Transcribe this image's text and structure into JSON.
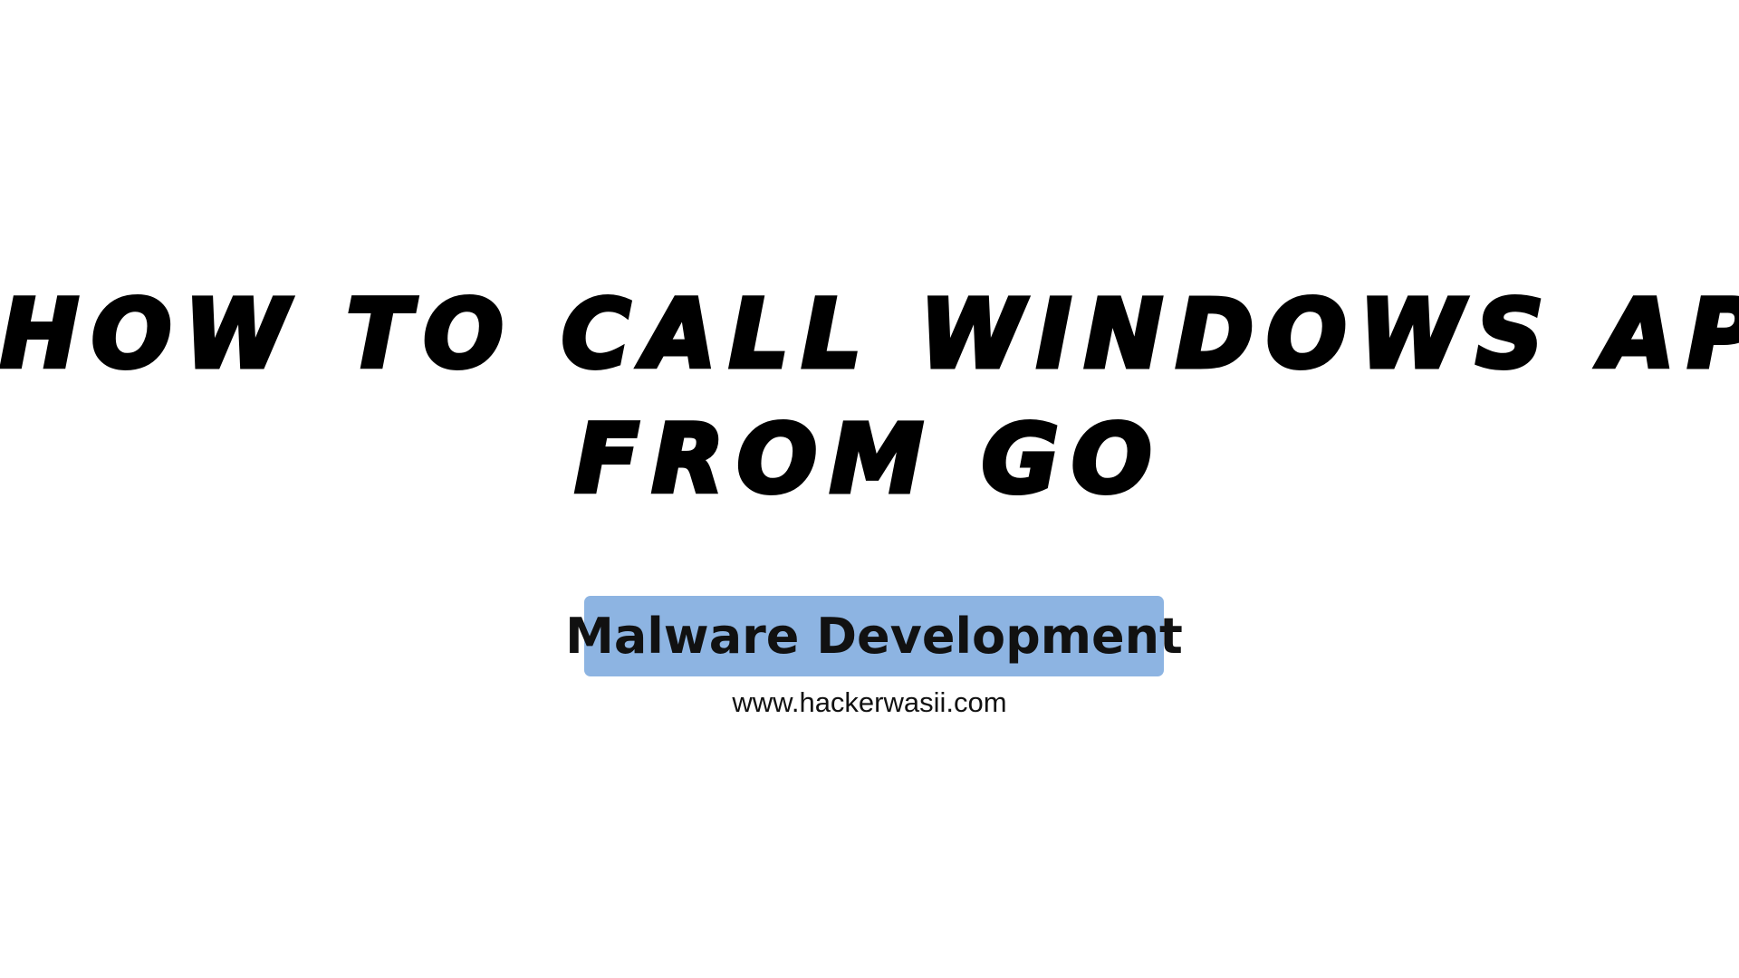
{
  "title": {
    "line1": "HOW TO CALL WINDOWS API",
    "line2": "FROM GO"
  },
  "badge": {
    "label": "Malware Development",
    "background_color": "#8db4e2"
  },
  "website": {
    "url": "www.hackerwasii.com"
  }
}
